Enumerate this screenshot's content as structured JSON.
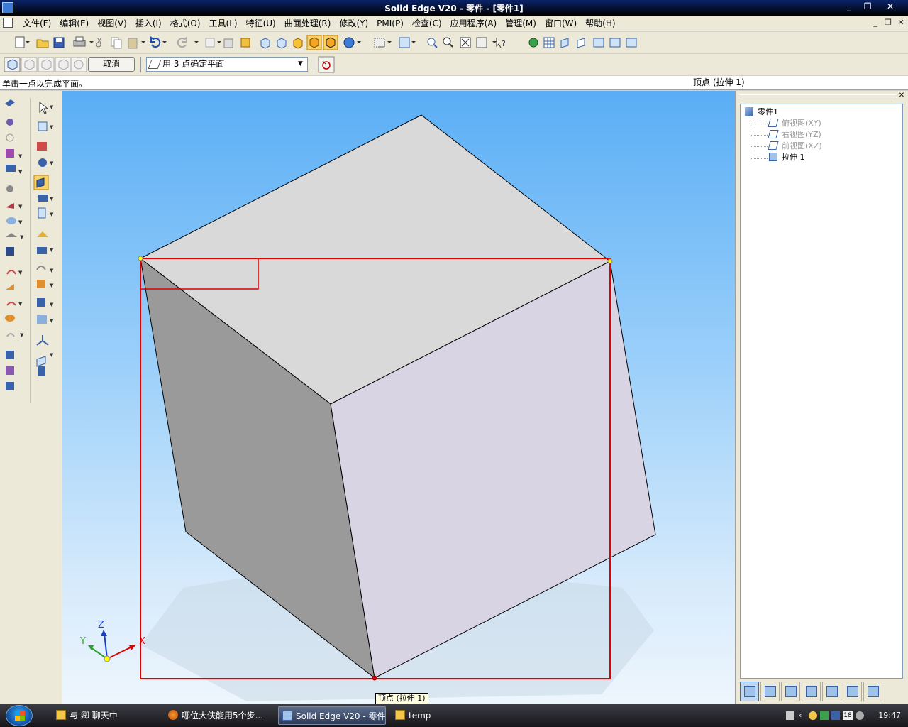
{
  "window": {
    "title": "Solid Edge V20 - 零件 - [零件1]",
    "minimize": "_",
    "restore": "❐",
    "close": "✕"
  },
  "menubar": {
    "items": [
      "文件(F)",
      "编辑(E)",
      "视图(V)",
      "插入(I)",
      "格式(O)",
      "工具(L)",
      "特征(U)",
      "曲面处理(R)",
      "修改(Y)",
      "PMI(P)",
      "检查(C)",
      "应用程序(A)",
      "管理(M)",
      "窗口(W)",
      "帮助(H)"
    ],
    "mdi_minimize": "_",
    "mdi_restore": "❐",
    "mdi_close": "✕"
  },
  "command_bar": {
    "cancel_label": "取消",
    "plane_select_value": "用 3 点确定平面"
  },
  "prompt": {
    "text": "单击一点以完成平面。",
    "status": "顶点 (拉伸 1)"
  },
  "viewport": {
    "tooltip": "顶点 (拉伸 1)",
    "axis_x": "X",
    "axis_y": "Y",
    "axis_z": "Z",
    "colors": {
      "highlight": "#e00000",
      "top_face": "#d9d9d9",
      "left_face": "#9a9a9a",
      "right_face": "#d8d4e4",
      "vertex": "#ffff00"
    }
  },
  "pathfinder": {
    "close": "✕",
    "root": "零件1",
    "items": [
      {
        "label": "俯视图(XY)",
        "dim": true
      },
      {
        "label": "右视图(YZ)",
        "dim": true
      },
      {
        "label": "前视图(XZ)",
        "dim": true
      },
      {
        "label": "拉伸 1",
        "dim": false
      }
    ]
  },
  "taskbar": {
    "buttons": [
      {
        "label": "与 卿 聊天中",
        "active": false
      },
      {
        "label": "哪位大侠能用5个步...",
        "active": false
      },
      {
        "label": "Solid Edge V20 - 零件 ...",
        "active": true
      },
      {
        "label": "temp",
        "active": false
      }
    ],
    "clock": "19:47",
    "tray_badge": "18"
  }
}
